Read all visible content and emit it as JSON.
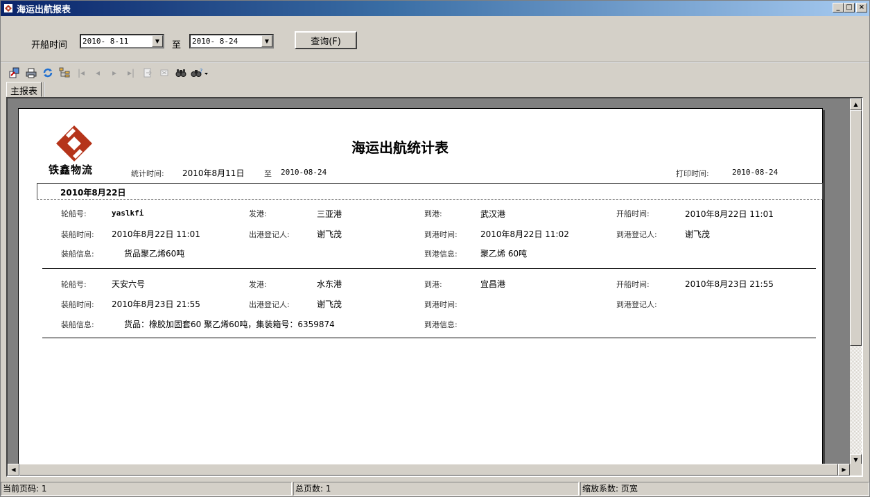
{
  "window": {
    "title": "海运出航报表",
    "minimize": "_",
    "restore": "□",
    "close": "×"
  },
  "query": {
    "start_label": "开船时间",
    "start_value": "2010- 8-11",
    "to_label": "至",
    "end_value": "2010- 8-24",
    "search_button": "查询(F)"
  },
  "toolbar": {
    "icons": [
      "export-icon",
      "print-icon",
      "refresh-icon",
      "tree-icon",
      "first-page-icon",
      "prev-page-icon",
      "next-page-icon",
      "last-page-icon",
      "goto-page-icon",
      "stop-icon",
      "find-icon",
      "zoom-icon"
    ]
  },
  "tabs": [
    {
      "label": "主报表"
    }
  ],
  "report": {
    "logo_text": "铁鑫物流",
    "title": "海运出航统计表",
    "stat_time_label": "统计时间:",
    "stat_time_start": "2010年8月11日",
    "stat_time_to": "至",
    "stat_time_end": "2010-08-24",
    "print_time_label": "打印时间:",
    "print_time_value": "2010-08-24",
    "group_header": "2010年8月22日",
    "records": [
      {
        "ship_no_label": "轮船号:",
        "ship_no": "yaslkfi",
        "from_port_label": "发港:",
        "from_port": "三亚港",
        "to_port_label": "到港:",
        "to_port": "武汉港",
        "sail_time_label": "开船时间:",
        "sail_time": "2010年8月22日  11:01",
        "load_time_label": "装船时间:",
        "load_time": "2010年8月22日  11:01",
        "out_reg_label": "出港登记人:",
        "out_reg": "谢飞茂",
        "arrive_time_label": "到港时间:",
        "arrive_time": "2010年8月22日  11:02",
        "in_reg_label": "到港登记人:",
        "in_reg": "谢飞茂",
        "load_info_label": "装船信息:",
        "load_info": "货品聚乙烯60吨",
        "arrive_info_label": "到港信息:",
        "arrive_info": "聚乙烯 60吨"
      },
      {
        "ship_no_label": "轮船号:",
        "ship_no": "天安六号",
        "from_port_label": "发港:",
        "from_port": "水东港",
        "to_port_label": "到港:",
        "to_port": "宜昌港",
        "sail_time_label": "开船时间:",
        "sail_time": "2010年8月23日  21:55",
        "load_time_label": "装船时间:",
        "load_time": "2010年8月23日  21:55",
        "out_reg_label": "出港登记人:",
        "out_reg": "谢飞茂",
        "arrive_time_label": "到港时间:",
        "arrive_time": "",
        "in_reg_label": "到港登记人:",
        "in_reg": "",
        "load_info_label": "装船信息:",
        "load_info": "货品：橡胶加固套60 聚乙烯60吨，集装箱号：6359874",
        "arrive_info_label": "到港信息:",
        "arrive_info": ""
      }
    ]
  },
  "status": {
    "current_page": "当前页码: 1",
    "total_pages": "总页数: 1",
    "zoom": "缩放系数: 页宽"
  },
  "colors": {
    "titlebar": "#0a246a",
    "logo": "#b5341a",
    "face": "#d4d0c8"
  }
}
